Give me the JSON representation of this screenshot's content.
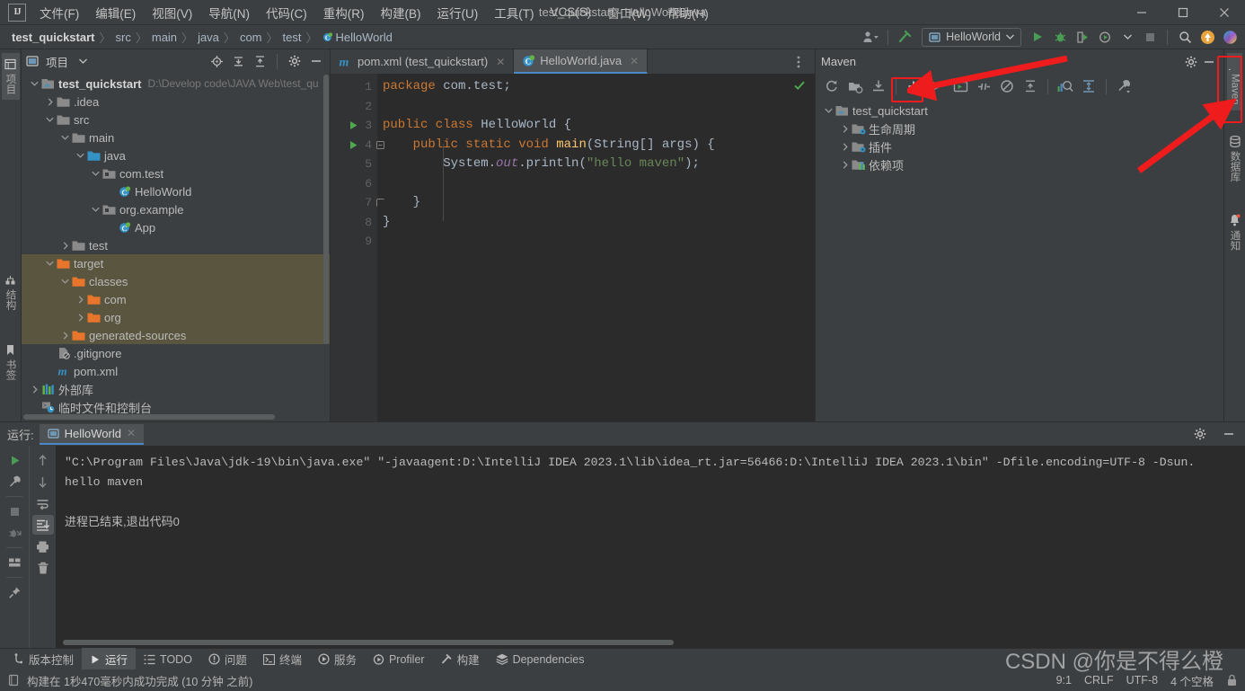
{
  "window": {
    "title": "test_quickstart - HelloWorld.java",
    "logo": "IJ",
    "minimize": "—",
    "maximize": "☐",
    "close": "✕"
  },
  "menu": [
    {
      "label": "文件(F)",
      "name": "menu-file"
    },
    {
      "label": "编辑(E)",
      "name": "menu-edit"
    },
    {
      "label": "视图(V)",
      "name": "menu-view"
    },
    {
      "label": "导航(N)",
      "name": "menu-navigate"
    },
    {
      "label": "代码(C)",
      "name": "menu-code"
    },
    {
      "label": "重构(R)",
      "name": "menu-refactor"
    },
    {
      "label": "构建(B)",
      "name": "menu-build"
    },
    {
      "label": "运行(U)",
      "name": "menu-run"
    },
    {
      "label": "工具(T)",
      "name": "menu-tools"
    },
    {
      "label": "VCS(S)",
      "name": "menu-vcs"
    },
    {
      "label": "窗口(W)",
      "name": "menu-window"
    },
    {
      "label": "帮助(H)",
      "name": "menu-help"
    }
  ],
  "breadcrumbs": [
    {
      "label": "test_quickstart"
    },
    {
      "label": "src"
    },
    {
      "label": "main"
    },
    {
      "label": "java"
    },
    {
      "label": "com"
    },
    {
      "label": "test"
    },
    {
      "label": "HelloWorld"
    }
  ],
  "toolbar": {
    "run_config": "HelloWorld",
    "icons": [
      "user-icon",
      "hammer-icon",
      "run-icon",
      "debug-icon",
      "run-coverage-icon",
      "profiler-icon",
      "stop-icon",
      "search-icon",
      "update-icon",
      "ai-icon"
    ]
  },
  "project_panel": {
    "title": "项目",
    "tree": [
      {
        "indent": 0,
        "arrow": "down",
        "icon": "module-icon",
        "label": "test_quickstart",
        "bold": true,
        "path": "D:\\Develop code\\JAVA Web\\test_qu",
        "highlight": false
      },
      {
        "indent": 1,
        "arrow": "right",
        "icon": "folder-icon",
        "label": ".idea",
        "highlight": false
      },
      {
        "indent": 1,
        "arrow": "down",
        "icon": "folder-icon",
        "label": "src",
        "highlight": false
      },
      {
        "indent": 2,
        "arrow": "down",
        "icon": "folder-icon",
        "label": "main",
        "highlight": false
      },
      {
        "indent": 3,
        "arrow": "down",
        "icon": "source-folder-icon",
        "label": "java",
        "highlight": false
      },
      {
        "indent": 4,
        "arrow": "down",
        "icon": "package-icon",
        "label": "com.test",
        "highlight": false
      },
      {
        "indent": 5,
        "arrow": "none",
        "icon": "java-class-icon",
        "label": "HelloWorld",
        "highlight": false
      },
      {
        "indent": 4,
        "arrow": "down",
        "icon": "package-icon",
        "label": "org.example",
        "highlight": false
      },
      {
        "indent": 5,
        "arrow": "none",
        "icon": "java-class-icon",
        "label": "App",
        "highlight": false
      },
      {
        "indent": 2,
        "arrow": "right",
        "icon": "folder-icon",
        "label": "test",
        "highlight": false
      },
      {
        "indent": 1,
        "arrow": "down",
        "icon": "excluded-folder-icon",
        "label": "target",
        "highlight": true
      },
      {
        "indent": 2,
        "arrow": "down",
        "icon": "excluded-folder-icon",
        "label": "classes",
        "highlight": true
      },
      {
        "indent": 3,
        "arrow": "right",
        "icon": "excluded-folder-icon",
        "label": "com",
        "highlight": true
      },
      {
        "indent": 3,
        "arrow": "right",
        "icon": "excluded-folder-icon",
        "label": "org",
        "highlight": true
      },
      {
        "indent": 2,
        "arrow": "right",
        "icon": "excluded-folder-icon",
        "label": "generated-sources",
        "highlight": true
      },
      {
        "indent": 1,
        "arrow": "none",
        "icon": "gitignore-icon",
        "label": ".gitignore",
        "highlight": false
      },
      {
        "indent": 1,
        "arrow": "none",
        "icon": "maven-pom-icon",
        "label": "pom.xml",
        "highlight": false
      },
      {
        "indent": 0,
        "arrow": "right",
        "icon": "library-icon",
        "label": "外部库",
        "highlight": false
      },
      {
        "indent": 0,
        "arrow": "none",
        "icon": "scratches-icon",
        "label": "临时文件和控制台",
        "highlight": false
      }
    ]
  },
  "editor": {
    "tabs": [
      {
        "label": "pom.xml (test_quickstart)",
        "icon": "maven-pom-icon",
        "active": false
      },
      {
        "label": "HelloWorld.java",
        "icon": "java-class-icon",
        "active": true
      }
    ],
    "line_numbers": [
      "1",
      "2",
      "3",
      "4",
      "5",
      "6",
      "7",
      "8",
      "9"
    ],
    "code_lines": [
      [
        {
          "t": "kw",
          "s": "package"
        },
        {
          "t": "cls",
          "s": " com.test;"
        }
      ],
      [],
      [
        {
          "t": "kw",
          "s": "public class"
        },
        {
          "t": "cls",
          "s": " HelloWorld {"
        }
      ],
      [
        {
          "t": "cls",
          "s": "    "
        },
        {
          "t": "kw",
          "s": "public static void"
        },
        {
          "t": "fn",
          "s": " main"
        },
        {
          "t": "cls",
          "s": "(String[] args) {"
        }
      ],
      [
        {
          "t": "cls",
          "s": "        System."
        },
        {
          "t": "fld",
          "s": "out"
        },
        {
          "t": "cls",
          "s": ".println("
        },
        {
          "t": "str",
          "s": "\"hello maven\""
        },
        {
          "t": "cls",
          "s": ");"
        }
      ],
      [],
      [
        {
          "t": "cls",
          "s": "    }"
        }
      ],
      [
        {
          "t": "cls",
          "s": "}"
        }
      ],
      []
    ],
    "inspection_status": "ok-check"
  },
  "maven_panel": {
    "title": "Maven",
    "toolbar_icons": [
      "reload-icon",
      "add-maven-project-icon",
      "download-sources-icon",
      "add-icon",
      "run-icon",
      "execute-goal-icon",
      "skip-tests-icon",
      "offline-mode-icon",
      "collapse-all-icon",
      "show-dependencies-icon",
      "expand-icon",
      "settings-wrench-icon"
    ],
    "tree": [
      {
        "indent": 0,
        "arrow": "down",
        "icon": "maven-module-icon",
        "label": "test_quickstart"
      },
      {
        "indent": 1,
        "arrow": "right",
        "icon": "lifecycle-folder-icon",
        "label": "生命周期"
      },
      {
        "indent": 1,
        "arrow": "right",
        "icon": "plugins-folder-icon",
        "label": "插件"
      },
      {
        "indent": 1,
        "arrow": "right",
        "icon": "dependencies-folder-icon",
        "label": "依赖项"
      }
    ]
  },
  "left_stripe": [
    {
      "label": "项目",
      "icon": "project-icon",
      "active": true
    },
    {
      "label": "结构",
      "icon": "structure-icon",
      "active": false
    },
    {
      "label": "书签",
      "icon": "bookmarks-icon",
      "active": false
    }
  ],
  "right_stripe": [
    {
      "label": "Maven",
      "icon": "maven-icon",
      "active": true
    },
    {
      "label": "数据库",
      "icon": "database-icon",
      "active": false
    },
    {
      "label": "通知",
      "icon": "notifications-icon",
      "active": false
    }
  ],
  "run_panel": {
    "label": "运行:",
    "tab": "HelloWorld",
    "console_lines": [
      {
        "text": "\"C:\\Program Files\\Java\\jdk-19\\bin\\java.exe\" \"-javaagent:D:\\IntelliJ IDEA 2023.1\\lib\\idea_rt.jar=56466:D:\\IntelliJ IDEA 2023.1\\bin\" -Dfile.encoding=UTF-8 -Dsun.",
        "cn": false
      },
      {
        "text": "hello maven",
        "cn": false
      },
      {
        "text": "",
        "cn": false
      },
      {
        "text": "进程已结束,退出代码0",
        "cn": true
      }
    ],
    "tools": [
      "rerun-icon",
      "wrench-icon",
      "stop-icon",
      "dump-threads-icon",
      "layout-icon",
      "pin-icon"
    ],
    "tools2": [
      "up-icon",
      "down-icon",
      "soft-wrap-icon",
      "scroll-to-end-icon",
      "print-icon",
      "clear-all-icon"
    ]
  },
  "bottom_toolbar": [
    {
      "label": "版本控制",
      "icon": "vcs-icon",
      "active": false
    },
    {
      "label": "运行",
      "icon": "run-icon",
      "active": true
    },
    {
      "label": "TODO",
      "icon": "todo-icon",
      "active": false
    },
    {
      "label": "问题",
      "icon": "problems-icon",
      "active": false
    },
    {
      "label": "终端",
      "icon": "terminal-icon",
      "active": false
    },
    {
      "label": "服务",
      "icon": "services-icon",
      "active": false
    },
    {
      "label": "Profiler",
      "icon": "profiler-icon",
      "active": false
    },
    {
      "label": "构建",
      "icon": "build-icon",
      "active": false
    },
    {
      "label": "Dependencies",
      "icon": "dependencies-icon",
      "active": false
    }
  ],
  "status_bar": {
    "message": "构建在 1秒470毫秒内成功完成 (10 分钟 之前)",
    "icon": "build-status-icon",
    "caret": "9:1",
    "line_separator": "CRLF",
    "encoding": "UTF-8",
    "indent": "4 个空格",
    "lock": "lock-icon"
  },
  "watermark": "CSDN @你是不得么橙",
  "colors": {
    "accent_blue": "#4A88C7",
    "annotation_red": "#EE1C1C",
    "folder_orange": "#E8752C",
    "keyword_orange": "#CC7832",
    "string_green": "#6A8759",
    "panel_bg": "#3C3F41",
    "editor_bg": "#2B2B2B",
    "excluded_bg": "#5A553F"
  }
}
